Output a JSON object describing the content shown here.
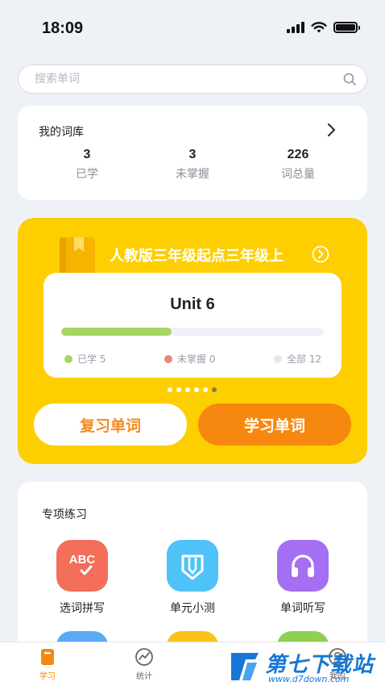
{
  "status": {
    "time": "18:09"
  },
  "search": {
    "placeholder": "搜索单词"
  },
  "library": {
    "title": "我的词库",
    "stats": [
      {
        "value": "3",
        "label": "已学"
      },
      {
        "value": "3",
        "label": "未掌握"
      },
      {
        "value": "226",
        "label": "词总量"
      }
    ]
  },
  "book": {
    "title": "人教版三年级起点三年级上",
    "unit": "Unit 6",
    "progress": 0.42,
    "legend": {
      "learned": "已学 5",
      "unmastered": "未掌握 0",
      "total": "全部 12"
    },
    "colors": {
      "learned": "#a5d663",
      "unmastered": "#f0857a",
      "total": "#e6e8eb"
    },
    "pager": {
      "count": 6,
      "active_index": 5
    },
    "review_button": "复习单词",
    "learn_button": "学习单词"
  },
  "practice": {
    "title": "专项练习",
    "items": [
      {
        "label": "选词拼写",
        "icon": "abc-check-icon",
        "color": "#f36f5a"
      },
      {
        "label": "单元小测",
        "icon": "pencil-badge-icon",
        "color": "#4fc3f7"
      },
      {
        "label": "单词听写",
        "icon": "headphones-icon",
        "color": "#a46ff2"
      }
    ],
    "next_row_colors": [
      "#5aa9f5",
      "#fbc21a",
      "#8fd04e"
    ]
  },
  "tabbar": {
    "items": [
      {
        "label": "学习",
        "icon": "book-icon",
        "active": true
      },
      {
        "label": "统计",
        "icon": "chart-icon",
        "active": false
      },
      {
        "label": "我的",
        "icon": "profile-icon",
        "active": false
      }
    ]
  },
  "watermark": {
    "brand": "第七下载站",
    "url": "www.d7down.com"
  }
}
